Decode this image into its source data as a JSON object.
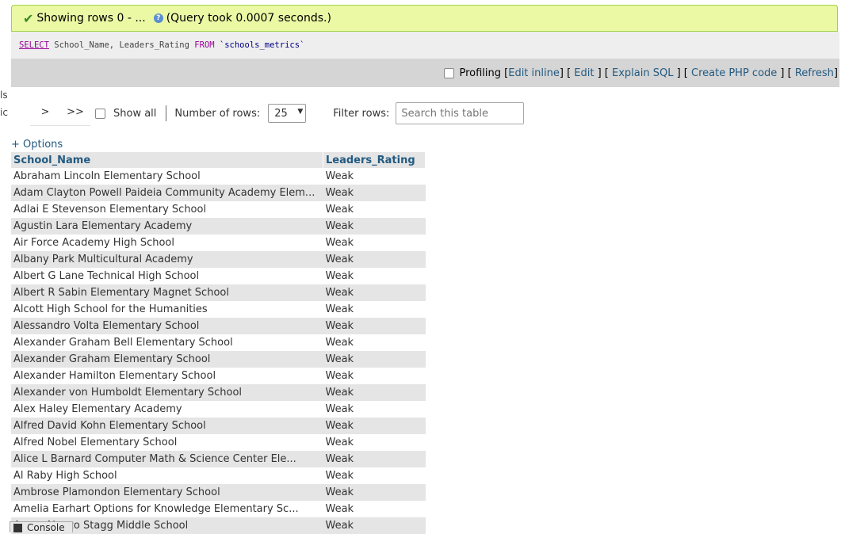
{
  "left_clip": {
    "a": "ls",
    "b": "ic"
  },
  "success": {
    "message": "Showing rows 0 - ...",
    "query_time": "(Query took 0.0007 seconds.)"
  },
  "sql": {
    "select": "SELECT",
    "columns": " School_Name, Leaders_Rating ",
    "from": "FROM",
    "table": " `schools_metrics`"
  },
  "toolbar": {
    "profiling": "Profiling",
    "edit_inline": "Edit inline",
    "edit": "Edit",
    "explain": "Explain SQL",
    "php": "Create PHP code",
    "refresh": "Refresh"
  },
  "nav": {
    "next": ">",
    "last": ">>",
    "show_all": "Show all",
    "rows_label": "Number of rows:",
    "rows_value": "25",
    "filter_label": "Filter rows:",
    "filter_placeholder": "Search this table"
  },
  "options": "+ Options",
  "table": {
    "headers": [
      "School_Name",
      "Leaders_Rating"
    ],
    "rows": [
      [
        "Abraham Lincoln Elementary School",
        "Weak"
      ],
      [
        "Adam Clayton Powell Paideia Community Academy Elem...",
        "Weak"
      ],
      [
        "Adlai E Stevenson Elementary School",
        "Weak"
      ],
      [
        "Agustin Lara Elementary Academy",
        "Weak"
      ],
      [
        "Air Force Academy High School",
        "Weak"
      ],
      [
        "Albany Park Multicultural Academy",
        "Weak"
      ],
      [
        "Albert G Lane Technical High School",
        "Weak"
      ],
      [
        "Albert R Sabin Elementary Magnet School",
        "Weak"
      ],
      [
        "Alcott High School for the Humanities",
        "Weak"
      ],
      [
        "Alessandro Volta Elementary School",
        "Weak"
      ],
      [
        "Alexander Graham Bell Elementary School",
        "Weak"
      ],
      [
        "Alexander Graham Elementary School",
        "Weak"
      ],
      [
        "Alexander Hamilton Elementary School",
        "Weak"
      ],
      [
        "Alexander von Humboldt Elementary School",
        "Weak"
      ],
      [
        "Alex Haley Elementary Academy",
        "Weak"
      ],
      [
        "Alfred David Kohn Elementary School",
        "Weak"
      ],
      [
        "Alfred Nobel Elementary School",
        "Weak"
      ],
      [
        "Alice L Barnard Computer Math & Science Center Ele...",
        "Weak"
      ],
      [
        "Al Raby High School",
        "Weak"
      ],
      [
        "Ambrose Plamondon Elementary School",
        "Weak"
      ],
      [
        "Amelia Earhart Options for Knowledge Elementary Sc...",
        "Weak"
      ],
      [
        "Amos Alonzo Stagg Middle School",
        "Weak"
      ]
    ]
  },
  "console": "Console"
}
